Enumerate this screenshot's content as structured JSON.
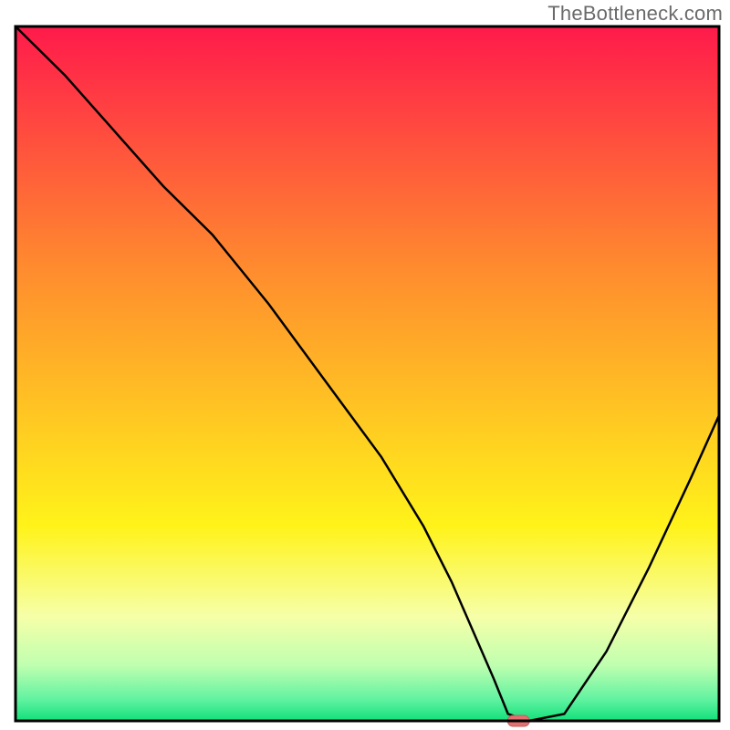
{
  "watermark": "TheBottleneck.com",
  "chart_data": {
    "type": "line",
    "title": "",
    "xlabel": "",
    "ylabel": "",
    "xlim": [
      0,
      100
    ],
    "ylim": [
      0,
      100
    ],
    "x": [
      0,
      7,
      14,
      21,
      28,
      36,
      44,
      52,
      58,
      62,
      65,
      68,
      70,
      73,
      78,
      84,
      90,
      96,
      100
    ],
    "values": [
      100,
      93,
      85,
      77,
      70,
      60,
      49,
      38,
      28,
      20,
      13,
      6,
      1,
      0,
      1,
      10,
      22,
      35,
      44
    ],
    "marker": {
      "x": 71.5,
      "y": 0
    },
    "colors": {
      "gradient_stops": [
        {
          "offset": 0.0,
          "color": "#ff1a4b"
        },
        {
          "offset": 0.15,
          "color": "#ff4b3f"
        },
        {
          "offset": 0.35,
          "color": "#ff8c2e"
        },
        {
          "offset": 0.55,
          "color": "#ffc423"
        },
        {
          "offset": 0.72,
          "color": "#fff31a"
        },
        {
          "offset": 0.85,
          "color": "#f6ffa8"
        },
        {
          "offset": 0.92,
          "color": "#bfffb0"
        },
        {
          "offset": 0.97,
          "color": "#5ff2a0"
        },
        {
          "offset": 1.0,
          "color": "#12e07a"
        }
      ],
      "line": "#000000",
      "border": "#000000",
      "marker_fill": "#e37070",
      "marker_stroke": "#c85a5a"
    }
  }
}
